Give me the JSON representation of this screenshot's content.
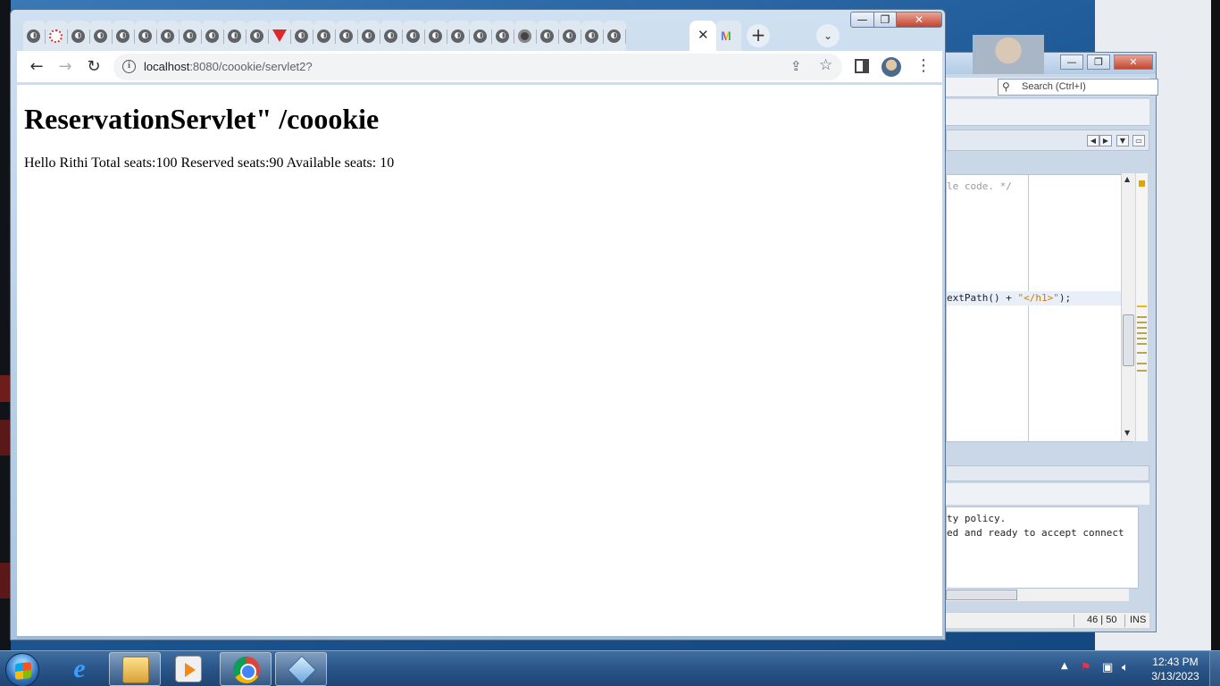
{
  "browser": {
    "url_host": "localhost",
    "url_rest": ":8080/coookie/servlet2?",
    "window_buttons": {
      "minimize": "—",
      "maximize": "❐",
      "close": "✕"
    },
    "active_tab_close": "✕",
    "new_tab_label": "+",
    "tab_search_label": "⌄",
    "menu_label": "⋮"
  },
  "page": {
    "heading": "ReservationServlet\" /coookie",
    "body": "Hello Rithi Total seats:100 Reserved seats:90 Available seats: 10"
  },
  "netbeans": {
    "search_placeholder": "Search (Ctrl+I)",
    "code_comment": "le code. */",
    "code_line_prefix": "extPath() + ",
    "code_line_string": "\"</h1>\"",
    "code_line_suffix": ");",
    "output_line1": "ty policy.",
    "output_line2": "ed and ready to accept connect",
    "caret_position": "46 | 50",
    "insert_mode": "INS"
  },
  "taskbar": {
    "time": "12:43 PM",
    "date": "3/13/2023"
  },
  "icons": {
    "tabs": [
      "globe",
      "red-ring",
      "globe",
      "globe",
      "globe",
      "globe",
      "globe",
      "globe",
      "globe",
      "globe",
      "globe",
      "red-triangle",
      "globe",
      "globe",
      "globe",
      "globe",
      "globe",
      "globe",
      "globe",
      "globe",
      "globe",
      "globe",
      "gear-globe",
      "globe",
      "globe",
      "globe",
      "globe"
    ]
  }
}
